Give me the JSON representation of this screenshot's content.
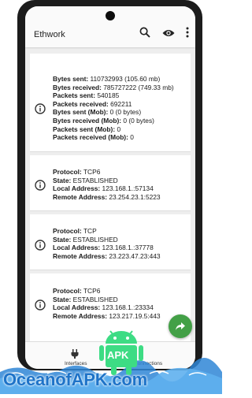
{
  "app": {
    "title": "Ethwork"
  },
  "connections": [
    {
      "lines": [
        {
          "label": "Bytes sent:",
          "value": " 110732993 (105.60 mb)"
        },
        {
          "label": "Bytes received:",
          "value": " 785727222 (749.33 mb)"
        },
        {
          "label": "Packets sent:",
          "value": " 540185"
        },
        {
          "label": "Packets received:",
          "value": " 692211"
        },
        {
          "label": "Bytes sent (Mob):",
          "value": " 0 (0 bytes)"
        },
        {
          "label": "Bytes received (Mob):",
          "value": " 0 (0 bytes)"
        },
        {
          "label": "Packets sent (Mob):",
          "value": " 0"
        },
        {
          "label": "Packets received (Mob):",
          "value": " 0"
        }
      ]
    },
    {
      "lines": [
        {
          "label": "Protocol:",
          "value": " TCP6"
        },
        {
          "label": "State:",
          "value": " ESTABLISHED"
        },
        {
          "label": "Local Address:",
          "value": " 123.168.1.:57134"
        },
        {
          "label": "Remote Address:",
          "value": " 23.254.23.1:5223"
        }
      ]
    },
    {
      "lines": [
        {
          "label": "Protocol:",
          "value": " TCP"
        },
        {
          "label": "State:",
          "value": " ESTABLISHED"
        },
        {
          "label": "Local Address:",
          "value": " 123.168.1.:37778"
        },
        {
          "label": "Remote Address:",
          "value": " 23.223.47.23:443"
        }
      ]
    },
    {
      "lines": [
        {
          "label": "Protocol:",
          "value": " TCP6"
        },
        {
          "label": "State:",
          "value": " ESTABLISHED"
        },
        {
          "label": "Local Address:",
          "value": " 123.168.1.:23334"
        },
        {
          "label": "Remote Address:",
          "value": " 123.217.19.5:443"
        }
      ]
    }
  ],
  "bottom_nav": {
    "tab1": "Interfaces",
    "tab2": "Connections"
  },
  "watermark": {
    "text": "OceanofAPK.com",
    "badge_text": "APK"
  },
  "colors": {
    "fab": "#43a047",
    "watermark_blue": "#1e73c8",
    "android_green": "#3ddc84"
  },
  "icons": [
    "search-icon",
    "eye-icon",
    "more-vert-icon",
    "info-icon",
    "share-icon",
    "plug-icon"
  ]
}
